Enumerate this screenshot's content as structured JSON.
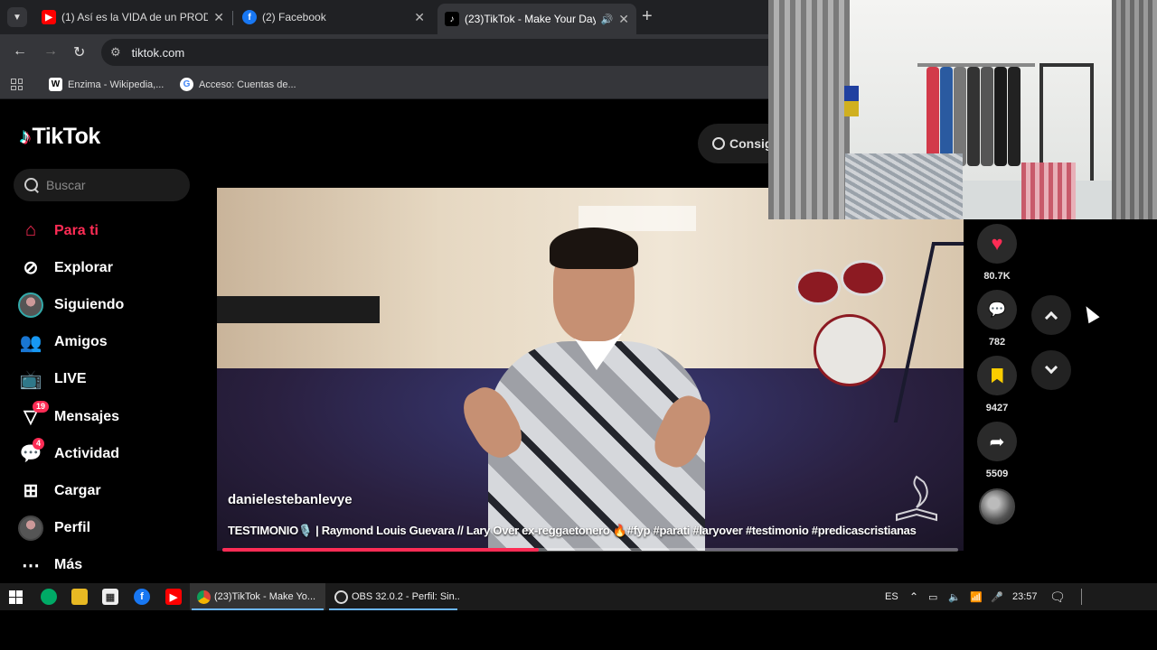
{
  "browser": {
    "tabs": [
      {
        "title": "(1) Así es la VIDA de un PRODU",
        "favicon": "youtube-icon",
        "color": "#ff0000"
      },
      {
        "title": "(2) Facebook",
        "favicon": "facebook-icon",
        "color": "#1877f2"
      },
      {
        "title": "(23)TikTok - Make Your Day",
        "favicon": "tiktok-icon",
        "color": "#000000",
        "active": true
      }
    ],
    "address": "tiktok.com",
    "bookmarks": [
      {
        "label": "Enzima - Wikipedia,...",
        "favicon": "wikipedia-icon"
      },
      {
        "label": "Acceso: Cuentas de...",
        "favicon": "google-icon"
      }
    ]
  },
  "tiktok": {
    "logo": "TikTok",
    "search_placeholder": "Buscar",
    "consig_label": "Consig",
    "nav": [
      {
        "label": "Para ti",
        "icon": "home-icon",
        "active": true
      },
      {
        "label": "Explorar",
        "icon": "compass-icon"
      },
      {
        "label": "Siguiendo",
        "icon": "following-avatar-icon"
      },
      {
        "label": "Amigos",
        "icon": "friends-icon"
      },
      {
        "label": "LIVE",
        "icon": "live-icon"
      },
      {
        "label": "Mensajes",
        "icon": "messages-icon",
        "badge": "19"
      },
      {
        "label": "Actividad",
        "icon": "activity-icon",
        "badge": "4"
      },
      {
        "label": "Cargar",
        "icon": "upload-icon"
      },
      {
        "label": "Perfil",
        "icon": "profile-avatar-icon"
      },
      {
        "label": "Más",
        "icon": "more-icon"
      }
    ],
    "video": {
      "username": "danielestebanlevye",
      "description": "TESTIMONIO🎙️ | Raymond Louis Guevara // Lary Over ex-reggaetonero 🔥#fyp #parati #laryover #testimonio #predicascristianas",
      "progress_percent": 43
    },
    "actions": [
      {
        "icon": "heart-icon",
        "count": "80.7K",
        "color": "#fe2c55"
      },
      {
        "icon": "comment-icon",
        "count": "782",
        "color": "#ffffff"
      },
      {
        "icon": "bookmark-icon",
        "count": "9427",
        "color": "#facd00"
      },
      {
        "icon": "share-icon",
        "count": "5509",
        "color": "#ffffff"
      }
    ],
    "accent": "#fe2c55"
  },
  "taskbar": {
    "apps": [
      {
        "label": "(23)TikTok - Make Yo...",
        "icon": "chrome-icon",
        "active": true
      },
      {
        "label": "OBS 32.0.2 - Perfil: Sin...",
        "icon": "obs-icon"
      }
    ],
    "language": "ES",
    "time": "23:57"
  }
}
